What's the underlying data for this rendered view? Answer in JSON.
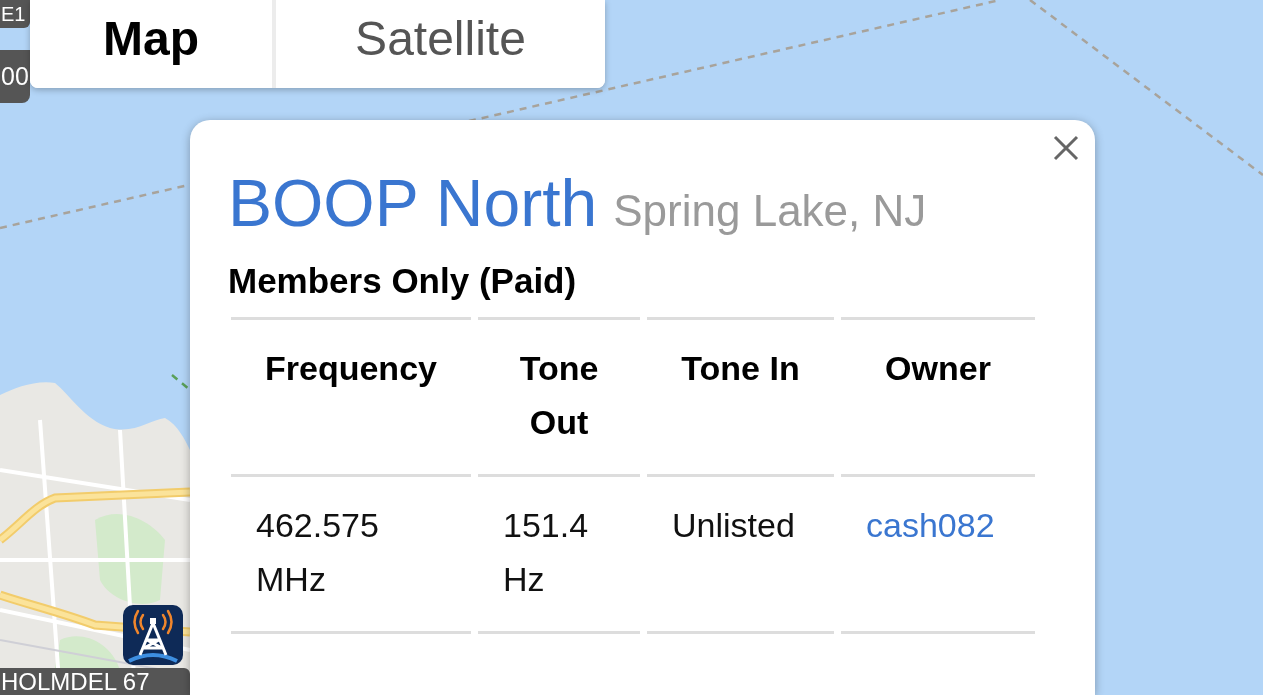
{
  "map_type_tabs": [
    {
      "label": "Map",
      "selected": true
    },
    {
      "label": "Satellite",
      "selected": false
    }
  ],
  "map_markers": [
    {
      "label": "E1"
    },
    {
      "label": "00"
    },
    {
      "label": "HOLMDEL 67"
    }
  ],
  "popup": {
    "title": "BOOP North",
    "location": "Spring Lake, NJ",
    "access": "Members Only (Paid)",
    "table": {
      "columns": [
        "Frequency",
        "Tone Out",
        "Tone In",
        "Owner"
      ],
      "rows": [
        {
          "cells": [
            {
              "kind": "text",
              "text": "462.575 MHz"
            },
            {
              "kind": "text",
              "text": "151.4 Hz"
            },
            {
              "kind": "text",
              "text": "Unlisted"
            },
            {
              "kind": "link",
              "text": "cash082"
            }
          ]
        }
      ]
    }
  }
}
